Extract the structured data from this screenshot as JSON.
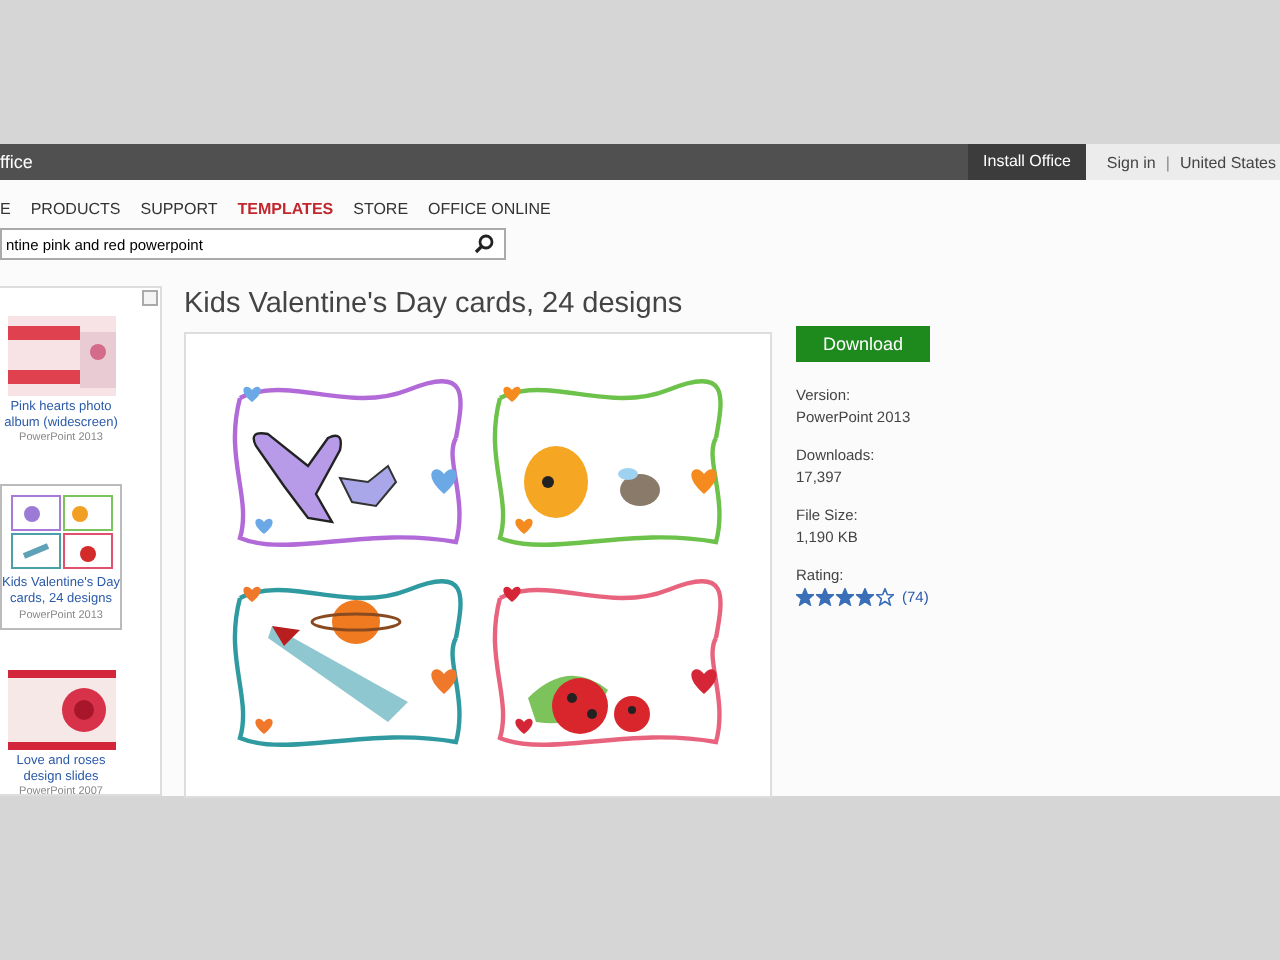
{
  "topbar": {
    "brand": "ffice",
    "install": "Install Office",
    "sign_in": "Sign in",
    "separator": "|",
    "region": "United States"
  },
  "nav": [
    {
      "label": "E",
      "selected": false
    },
    {
      "label": "PRODUCTS",
      "selected": false
    },
    {
      "label": "SUPPORT",
      "selected": false
    },
    {
      "label": "TEMPLATES",
      "selected": true
    },
    {
      "label": "STORE",
      "selected": false
    },
    {
      "label": "OFFICE ONLINE",
      "selected": false
    }
  ],
  "search": {
    "value": "ntine pink and red powerpoint"
  },
  "sidebar": {
    "items": [
      {
        "kind": "album",
        "title": "Pink hearts photo album (widescreen)",
        "product": "PowerPoint 2013",
        "selected": false
      },
      {
        "kind": "cards",
        "title": "Kids Valentine's Day cards, 24 designs",
        "product": "PowerPoint 2013",
        "selected": true
      },
      {
        "kind": "roses",
        "title": "Love and roses design slides",
        "product": "PowerPoint 2007",
        "selected": false
      }
    ]
  },
  "template": {
    "title": "Kids Valentine's Day cards, 24 designs",
    "download": "Download",
    "details": [
      {
        "label": "Version:",
        "value": "PowerPoint 2013"
      },
      {
        "label": "Downloads:",
        "value": "17,397"
      },
      {
        "label": "File Size:",
        "value": "1,190 KB"
      }
    ],
    "rating": {
      "label": "Rating:",
      "stars": 4,
      "count": "(74)"
    }
  }
}
